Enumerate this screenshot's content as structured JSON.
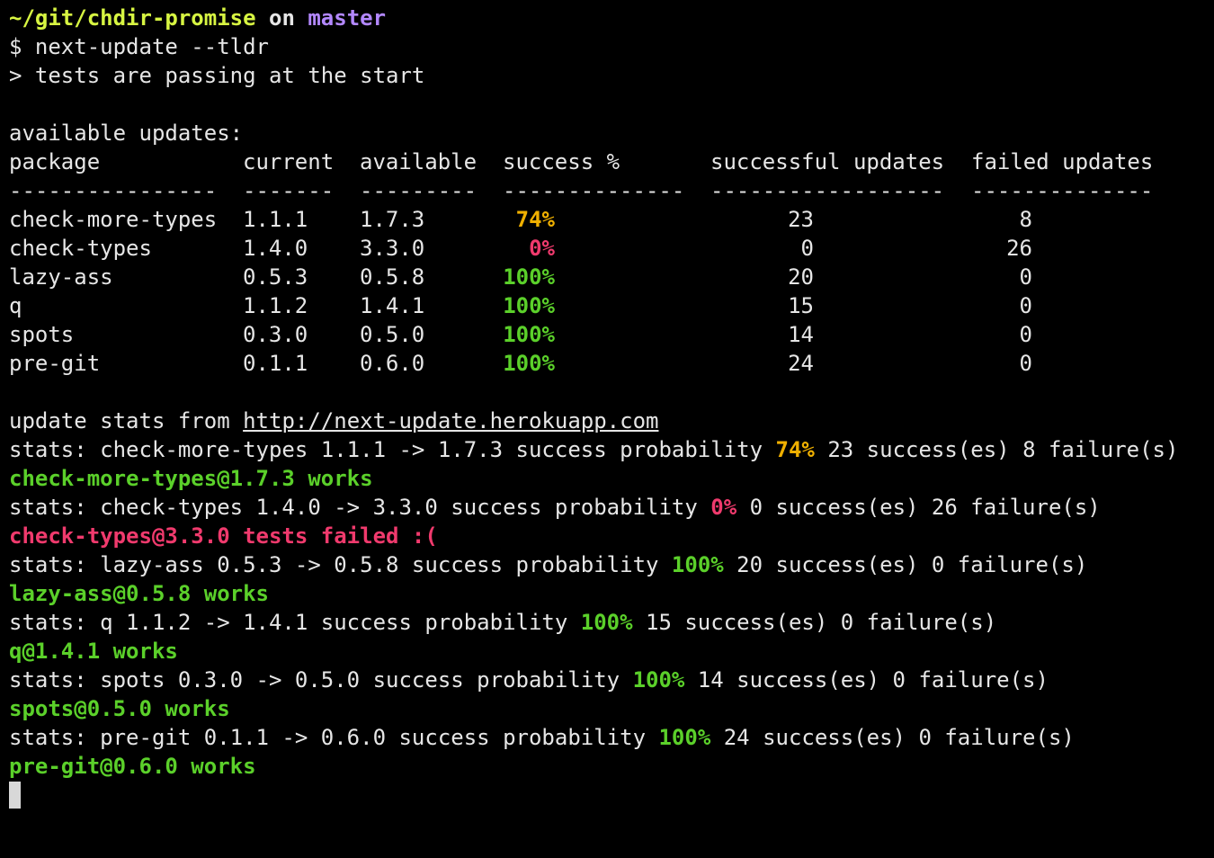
{
  "prompt": {
    "path": "~/git/chdir-promise",
    "on": "on",
    "branch": "master"
  },
  "command": "$ next-update --tldr",
  "start_msg": "> tests are passing at the start",
  "available_title": "available updates:",
  "table": {
    "headers": [
      "package",
      "current",
      "available",
      "success %",
      "successful updates",
      "failed updates"
    ],
    "rules": [
      "----------------",
      "-------",
      "---------",
      "--------------",
      "------------------",
      "--------------"
    ],
    "rows": [
      {
        "package": "check-more-types",
        "current": "1.1.1",
        "available": "1.7.3",
        "success": "74%",
        "successful": "23",
        "failed": "8",
        "color": "#f0b000"
      },
      {
        "package": "check-types",
        "current": "1.4.0",
        "available": "3.3.0",
        "success": "0%",
        "successful": "0",
        "failed": "26",
        "color": "#f03a6d"
      },
      {
        "package": "lazy-ass",
        "current": "0.5.3",
        "available": "0.5.8",
        "success": "100%",
        "successful": "20",
        "failed": "0",
        "color": "#5bd02a"
      },
      {
        "package": "q",
        "current": "1.1.2",
        "available": "1.4.1",
        "success": "100%",
        "successful": "15",
        "failed": "0",
        "color": "#5bd02a"
      },
      {
        "package": "spots",
        "current": "0.3.0",
        "available": "0.5.0",
        "success": "100%",
        "successful": "14",
        "failed": "0",
        "color": "#5bd02a"
      },
      {
        "package": "pre-git",
        "current": "0.1.1",
        "available": "0.6.0",
        "success": "100%",
        "successful": "24",
        "failed": "0",
        "color": "#5bd02a"
      }
    ]
  },
  "stats_source": {
    "label": "update stats from ",
    "url": "http://next-update.herokuapp.com"
  },
  "log": [
    {
      "stats": {
        "prefix": "stats: check-more-types 1.1.1 -> 1.7.3 success probability ",
        "pct": "74%",
        "suffix": " 23 success(es) 8 failure(s)",
        "color": "#f0b000"
      },
      "result": {
        "text": "check-more-types@1.7.3 works",
        "color": "#5bd02a"
      }
    },
    {
      "stats": {
        "prefix": "stats: check-types 1.4.0 -> 3.3.0 success probability ",
        "pct": "0%",
        "suffix": " 0 success(es) 26 failure(s)",
        "color": "#f03a6d"
      },
      "result": {
        "text": "check-types@3.3.0 tests failed :(",
        "color": "#f03a6d"
      }
    },
    {
      "stats": {
        "prefix": "stats: lazy-ass 0.5.3 -> 0.5.8 success probability ",
        "pct": "100%",
        "suffix": " 20 success(es) 0 failure(s)",
        "color": "#5bd02a"
      },
      "result": {
        "text": "lazy-ass@0.5.8 works",
        "color": "#5bd02a"
      }
    },
    {
      "stats": {
        "prefix": "stats: q 1.1.2 -> 1.4.1 success probability ",
        "pct": "100%",
        "suffix": " 15 success(es) 0 failure(s)",
        "color": "#5bd02a"
      },
      "result": {
        "text": "q@1.4.1 works",
        "color": "#5bd02a"
      }
    },
    {
      "stats": {
        "prefix": "stats: spots 0.3.0 -> 0.5.0 success probability ",
        "pct": "100%",
        "suffix": " 14 success(es) 0 failure(s)",
        "color": "#5bd02a"
      },
      "result": {
        "text": "spots@0.5.0 works",
        "color": "#5bd02a"
      }
    },
    {
      "stats": {
        "prefix": "stats: pre-git 0.1.1 -> 0.6.0 success probability ",
        "pct": "100%",
        "suffix": " 24 success(es) 0 failure(s)",
        "color": "#5bd02a"
      },
      "result": {
        "text": "pre-git@0.6.0 works",
        "color": "#5bd02a"
      }
    }
  ],
  "colors": {
    "background": "#000000",
    "text": "#e6e6e6",
    "path": "#d7f542",
    "branch": "#b388ff",
    "green": "#5bd02a",
    "red": "#f03a6d",
    "orange": "#f0b000"
  }
}
